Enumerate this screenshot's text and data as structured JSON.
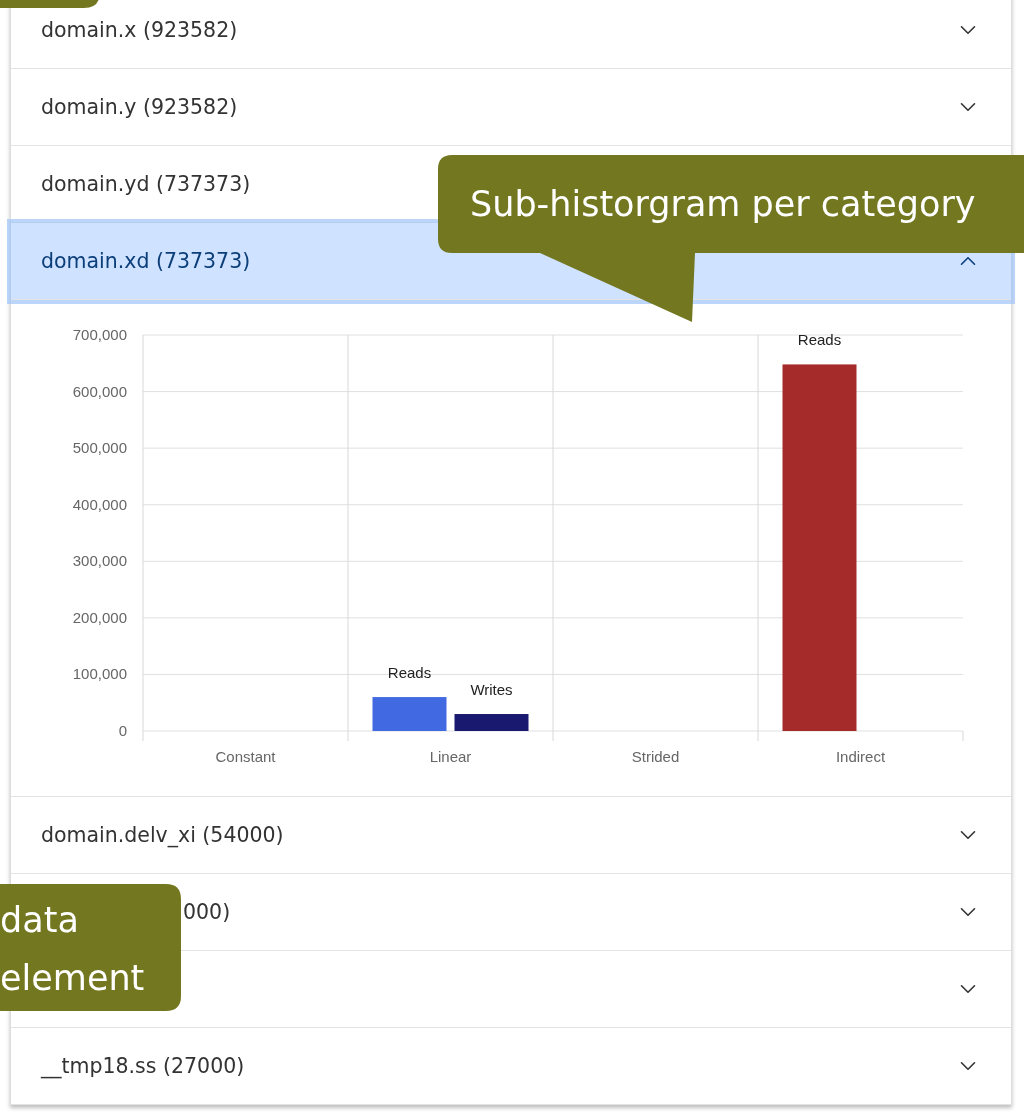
{
  "accordion": {
    "items": [
      {
        "label": "domain.x (923582)",
        "expanded": false,
        "selected": false
      },
      {
        "label": "domain.y (923582)",
        "expanded": false,
        "selected": false
      },
      {
        "label": "domain.yd (737373)",
        "selected": false
      },
      {
        "label": "domain.xd (737373)",
        "expanded": true,
        "selected": true,
        "chart_data": {
          "type": "bar",
          "categories": [
            "Constant",
            "Linear",
            "Strided",
            "Indirect"
          ],
          "ylim": [
            0,
            700000
          ],
          "yticks": [
            {
              "value": 0,
              "label": "0"
            },
            {
              "value": 100000,
              "label": "100,000"
            },
            {
              "value": 200000,
              "label": "200,000"
            },
            {
              "value": 300000,
              "label": "300,000"
            },
            {
              "value": 400000,
              "label": "400,000"
            },
            {
              "value": 500000,
              "label": "500,000"
            },
            {
              "value": 600000,
              "label": "600,000"
            },
            {
              "value": 700000,
              "label": "700,000"
            }
          ],
          "grid": true,
          "series": [
            {
              "name": "Reads",
              "color": "#4169e1",
              "values": [
                null,
                60000,
                null,
                null
              ]
            },
            {
              "name": "Writes",
              "color": "#191970",
              "values": [
                null,
                30000,
                null,
                null
              ]
            },
            {
              "name": "Reads",
              "color": "#a52a2a",
              "values": [
                null,
                null,
                null,
                648000
              ]
            }
          ]
        }
      },
      {
        "label": "domain.delv_xi (54000)",
        "expanded": false,
        "selected": false
      },
      {
        "label": "000)",
        "kind": "covered",
        "expanded": false,
        "selected": false
      },
      {
        "kind": "covered",
        "expanded": false,
        "selected": false
      },
      {
        "label": "__tmp18.ss (27000)",
        "expanded": false,
        "selected": false
      }
    ]
  },
  "callouts": [
    {
      "kind": "top-left"
    },
    {
      "kind": "chart",
      "lines": [
        "Sub-historgram per category"
      ]
    },
    {
      "kind": "element",
      "lines": [
        "data",
        "element"
      ]
    }
  ]
}
